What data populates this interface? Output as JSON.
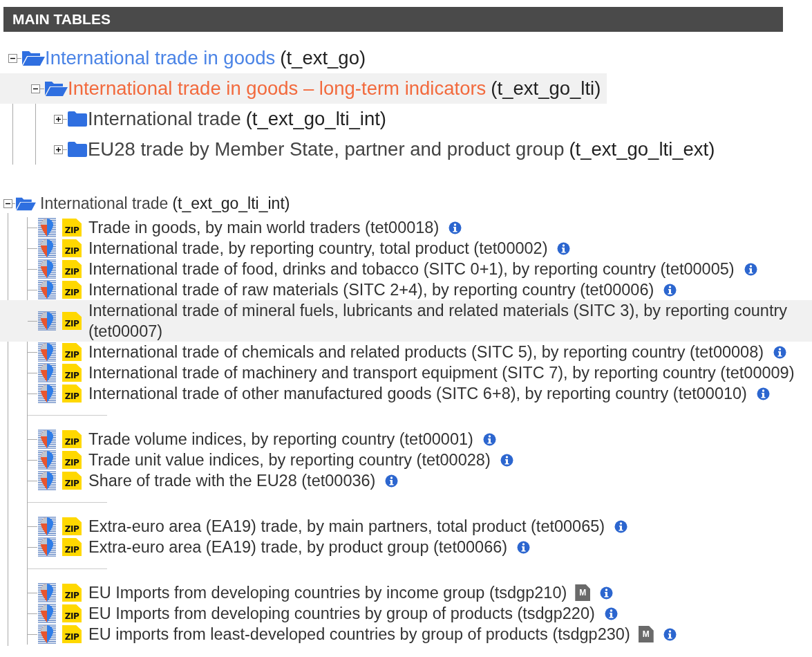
{
  "header": {
    "title": "MAIN TABLES"
  },
  "overview_tree": [
    {
      "label": "International trade in goods",
      "code": "(t_ext_go)",
      "expanded": true,
      "selected": false,
      "children": [
        {
          "label": "International trade in goods – long-term indicators",
          "code": "(t_ext_go_lti)",
          "expanded": true,
          "selected": true,
          "children": [
            {
              "label": "International trade",
              "code": "(t_ext_go_lti_int)",
              "expanded": false,
              "selected": false
            },
            {
              "label": "EU28 trade by Member State, partner and product group",
              "code": "(t_ext_go_lti_ext)",
              "expanded": false,
              "selected": false
            }
          ]
        }
      ]
    }
  ],
  "dataset_tree": {
    "label": "International trade",
    "code": "(t_ext_go_lti_int)",
    "expanded": true,
    "groups": [
      {
        "items": [
          {
            "title": "Trade in goods, by main world traders (tet00018)",
            "format": "ZIP",
            "info": true,
            "highlighted": false
          },
          {
            "title": "International trade, by reporting country, total product (tet00002)",
            "format": "ZIP",
            "info": true,
            "highlighted": false
          },
          {
            "title": "International trade of food, drinks and tobacco (SITC 0+1), by reporting country (tet00005)",
            "format": "ZIP",
            "info": true,
            "highlighted": false
          },
          {
            "title": "International trade of raw materials (SITC 2+4), by reporting country (tet00006)",
            "format": "ZIP",
            "info": true,
            "highlighted": false
          },
          {
            "title": "International trade of mineral fuels, lubricants and related materials (SITC 3), by reporting country (tet00007)",
            "format": "ZIP",
            "info": false,
            "highlighted": true
          },
          {
            "title": "International trade of chemicals and related products (SITC 5), by reporting country (tet00008)",
            "format": "ZIP",
            "info": true,
            "highlighted": false
          },
          {
            "title": "International trade of machinery and transport equipment (SITC 7), by reporting country (tet00009)",
            "format": "ZIP",
            "info": false,
            "highlighted": false
          },
          {
            "title": "International trade of other manufactured goods (SITC 6+8), by reporting country (tet00010)",
            "format": "ZIP",
            "info": true,
            "highlighted": false
          }
        ]
      },
      {
        "items": [
          {
            "title": "Trade volume indices, by reporting country (tet00001)",
            "format": "ZIP",
            "info": true,
            "highlighted": false
          },
          {
            "title": "Trade unit value indices, by reporting country (tet00028)",
            "format": "ZIP",
            "info": true,
            "highlighted": false
          },
          {
            "title": "Share of trade with the EU28 (tet00036)",
            "format": "ZIP",
            "info": true,
            "highlighted": false
          }
        ]
      },
      {
        "items": [
          {
            "title": "Extra-euro area (EA19) trade, by main partners, total product (tet00065)",
            "format": "ZIP",
            "info": true,
            "highlighted": false
          },
          {
            "title": "Extra-euro area (EA19) trade, by product group (tet00066)",
            "format": "ZIP",
            "info": true,
            "highlighted": false
          }
        ]
      },
      {
        "items": [
          {
            "title": "EU Imports from developing countries by income group (tsdgp210)",
            "format": "ZIP",
            "metadata": "M",
            "info": true,
            "highlighted": false
          },
          {
            "title": "EU Imports from developing countries by group of products (tsdgp220)",
            "format": "ZIP",
            "info": true,
            "highlighted": false
          },
          {
            "title": "EU imports from least-developed countries by group of products (tsdgp230)",
            "format": "ZIP",
            "metadata": "M",
            "info": true,
            "highlighted": false
          }
        ]
      }
    ]
  }
}
